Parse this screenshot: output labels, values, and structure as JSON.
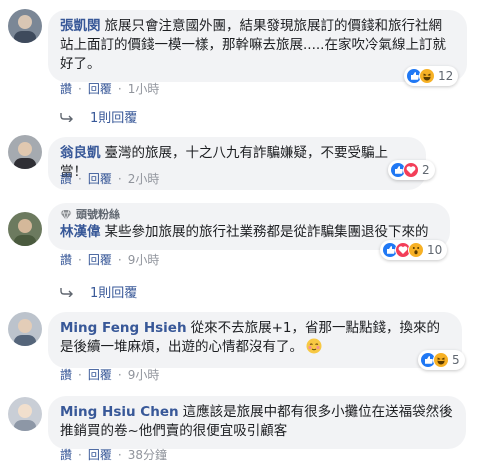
{
  "comments": [
    {
      "name": "張凱閔",
      "text": "旅展只會注意國外團，結果發現旅展訂的價錢和旅行社網站上面訂的價錢一模一樣，那幹嘛去旅展.....在家吹冷氣線上訂就好了。",
      "reaction_count": "12",
      "reactions": [
        "like-icon",
        "haha-icon"
      ],
      "actions": {
        "like": "讚",
        "reply": "回覆",
        "time": "1小時"
      },
      "replies_label": "1則回覆"
    },
    {
      "name": "翁良凱",
      "text": "臺灣的旅展，十之八九有詐騙嫌疑，不要受騙上當！",
      "reaction_count": "2",
      "reactions": [
        "like-icon",
        "love-icon"
      ],
      "actions": {
        "like": "讚",
        "reply": "回覆",
        "time": "2小時"
      }
    },
    {
      "badge": "頭號粉絲",
      "name": "林漢偉",
      "text": "某些參加旅展的旅行社業務都是從詐騙集團退役下來的",
      "reaction_count": "10",
      "reactions": [
        "like-icon",
        "love-icon",
        "wow-icon"
      ],
      "actions": {
        "like": "讚",
        "reply": "回覆",
        "time": "9小時"
      },
      "replies_label": "1則回覆"
    },
    {
      "name": "Ming Feng Hsieh",
      "text": "從來不去旅展+1，省那一點點錢，換來的是後續一堆麻煩，出遊的心情都沒有了。",
      "reaction_count": "5",
      "reactions": [
        "like-icon",
        "haha-icon"
      ],
      "actions": {
        "like": "讚",
        "reply": "回覆",
        "time": "9小時"
      }
    },
    {
      "name": "Ming Hsiu Chen",
      "text": "這應該是旅展中都有很多小攤位在送福袋然後推銷買的卷~他們賣的很便宜吸引顧客",
      "actions": {
        "like": "讚",
        "reply": "回覆",
        "time": "38分鐘"
      }
    }
  ],
  "colors": {
    "link": "#385898",
    "bubble": "#f2f3f5",
    "like": "#2078f4",
    "love": "#f33e58",
    "haha": "#f7b125"
  }
}
